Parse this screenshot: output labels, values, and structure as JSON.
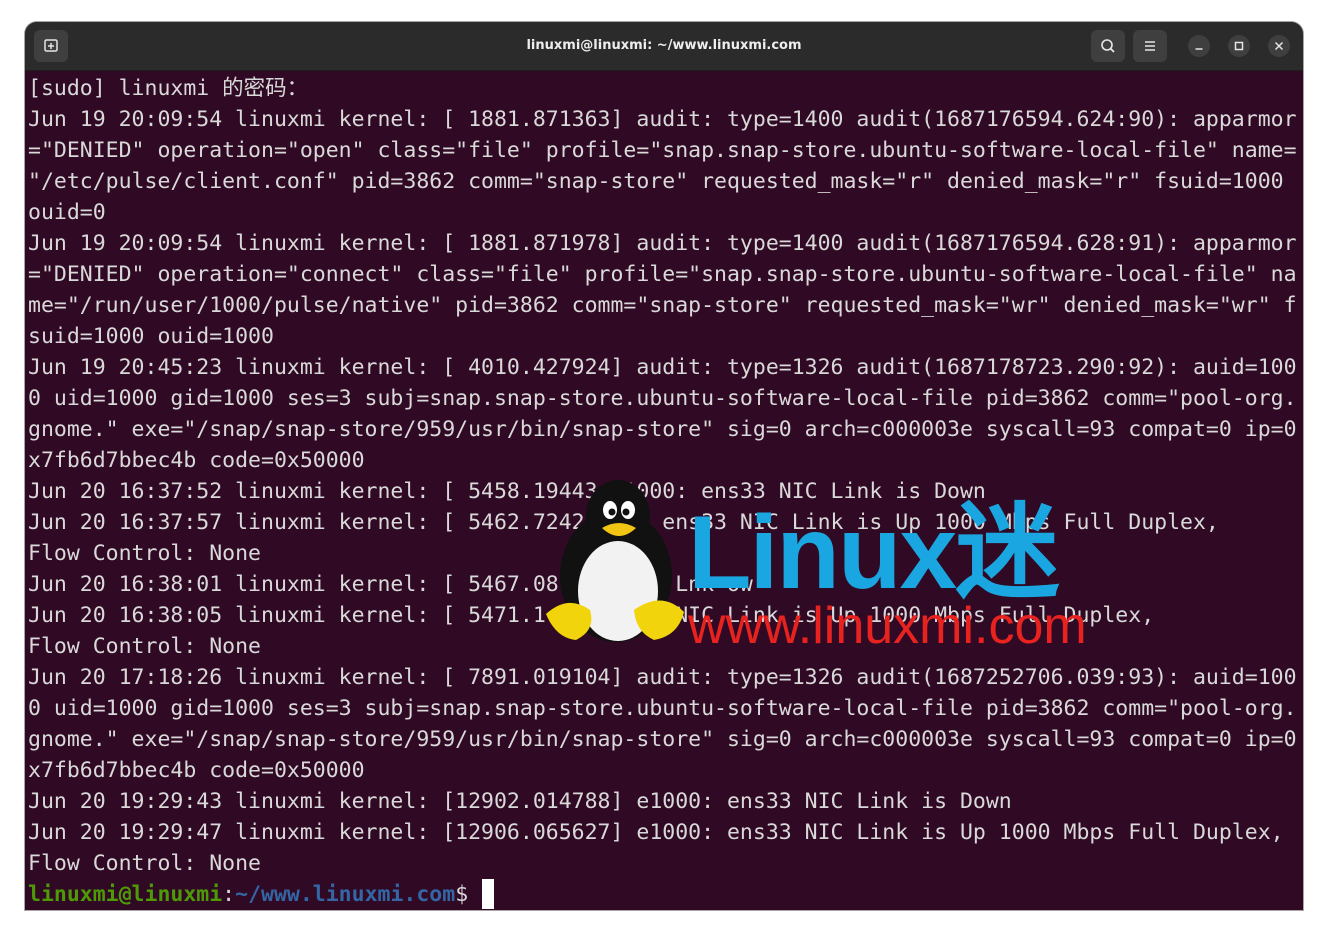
{
  "window": {
    "title": "linuxmi@linuxmi: ~/www.linuxmi.com"
  },
  "titlebar_icons": {
    "new_tab": "new-tab-icon",
    "search": "search-icon",
    "menu": "hamburger-menu-icon",
    "minimize": "minimize-icon",
    "maximize": "maximize-icon",
    "close": "close-icon"
  },
  "terminal": {
    "lines": [
      "[sudo] linuxmi 的密码：",
      "Jun 19 20:09:54 linuxmi kernel: [ 1881.871363] audit: type=1400 audit(1687176594.624:90): apparmor",
      "=\"DENIED\" operation=\"open\" class=\"file\" profile=\"snap.snap-store.ubuntu-software-local-file\" name=",
      "\"/etc/pulse/client.conf\" pid=3862 comm=\"snap-store\" requested_mask=\"r\" denied_mask=\"r\" fsuid=1000",
      "ouid=0",
      "Jun 19 20:09:54 linuxmi kernel: [ 1881.871978] audit: type=1400 audit(1687176594.628:91): apparmor",
      "=\"DENIED\" operation=\"connect\" class=\"file\" profile=\"snap.snap-store.ubuntu-software-local-file\" na",
      "me=\"/run/user/1000/pulse/native\" pid=3862 comm=\"snap-store\" requested_mask=\"wr\" denied_mask=\"wr\" f",
      "suid=1000 ouid=1000",
      "Jun 19 20:45:23 linuxmi kernel: [ 4010.427924] audit: type=1326 audit(1687178723.290:92): auid=100",
      "0 uid=1000 gid=1000 ses=3 subj=snap.snap-store.ubuntu-software-local-file pid=3862 comm=\"pool-org.",
      "gnome.\" exe=\"/snap/snap-store/959/usr/bin/snap-store\" sig=0 arch=c000003e syscall=93 compat=0 ip=0",
      "x7fb6d7bbec4b code=0x50000",
      "Jun 20 16:37:52 linuxmi kernel: [ 5458.19443 e1000: ens33 NIC Link is Down",
      "Jun 20 16:37:57 linuxmi kernel: [ 5462.7242 e100 ens33 NIC Link is Up 1000 Mbps Full Duplex,",
      "Flow Control: None",
      "Jun 20 16:38:01 linuxmi kernel: [ 5467.08 00 s3 N Lnk ow",
      "Jun 20 16:38:05 linuxmi kernel: [ 5471.1 0: ens33 NIC Link is Up 1000 Mbps Full Duplex,",
      "Flow Control: None",
      "Jun 20 17:18:26 linuxmi kernel: [ 7891.019104] audit: type=1326 audit(1687252706.039:93): auid=100",
      "0 uid=1000 gid=1000 ses=3 subj=snap.snap-store.ubuntu-software-local-file pid=3862 comm=\"pool-org.",
      "gnome.\" exe=\"/snap/snap-store/959/usr/bin/snap-store\" sig=0 arch=c000003e syscall=93 compat=0 ip=0",
      "x7fb6d7bbec4b code=0x50000",
      "Jun 20 19:29:43 linuxmi kernel: [12902.014788] e1000: ens33 NIC Link is Down",
      "Jun 20 19:29:47 linuxmi kernel: [12906.065627] e1000: ens33 NIC Link is Up 1000 Mbps Full Duplex,",
      "Flow Control: None"
    ],
    "prompt": {
      "user_host": "linuxmi@linuxmi",
      "separator": ":",
      "path": "~/www.linuxmi.com",
      "symbol": "$"
    }
  },
  "watermark": {
    "brand": "Linux迷",
    "url": "www.linuxmi.com",
    "logo_icon": "tux-penguin-icon"
  },
  "colors": {
    "terminal_bg": "#300a24",
    "titlebar_bg": "#2b2b2b",
    "prompt_user": "#4e9a06",
    "prompt_path": "#3465a4",
    "watermark_blue": "#1aa6e0",
    "watermark_red": "#e8231f"
  }
}
